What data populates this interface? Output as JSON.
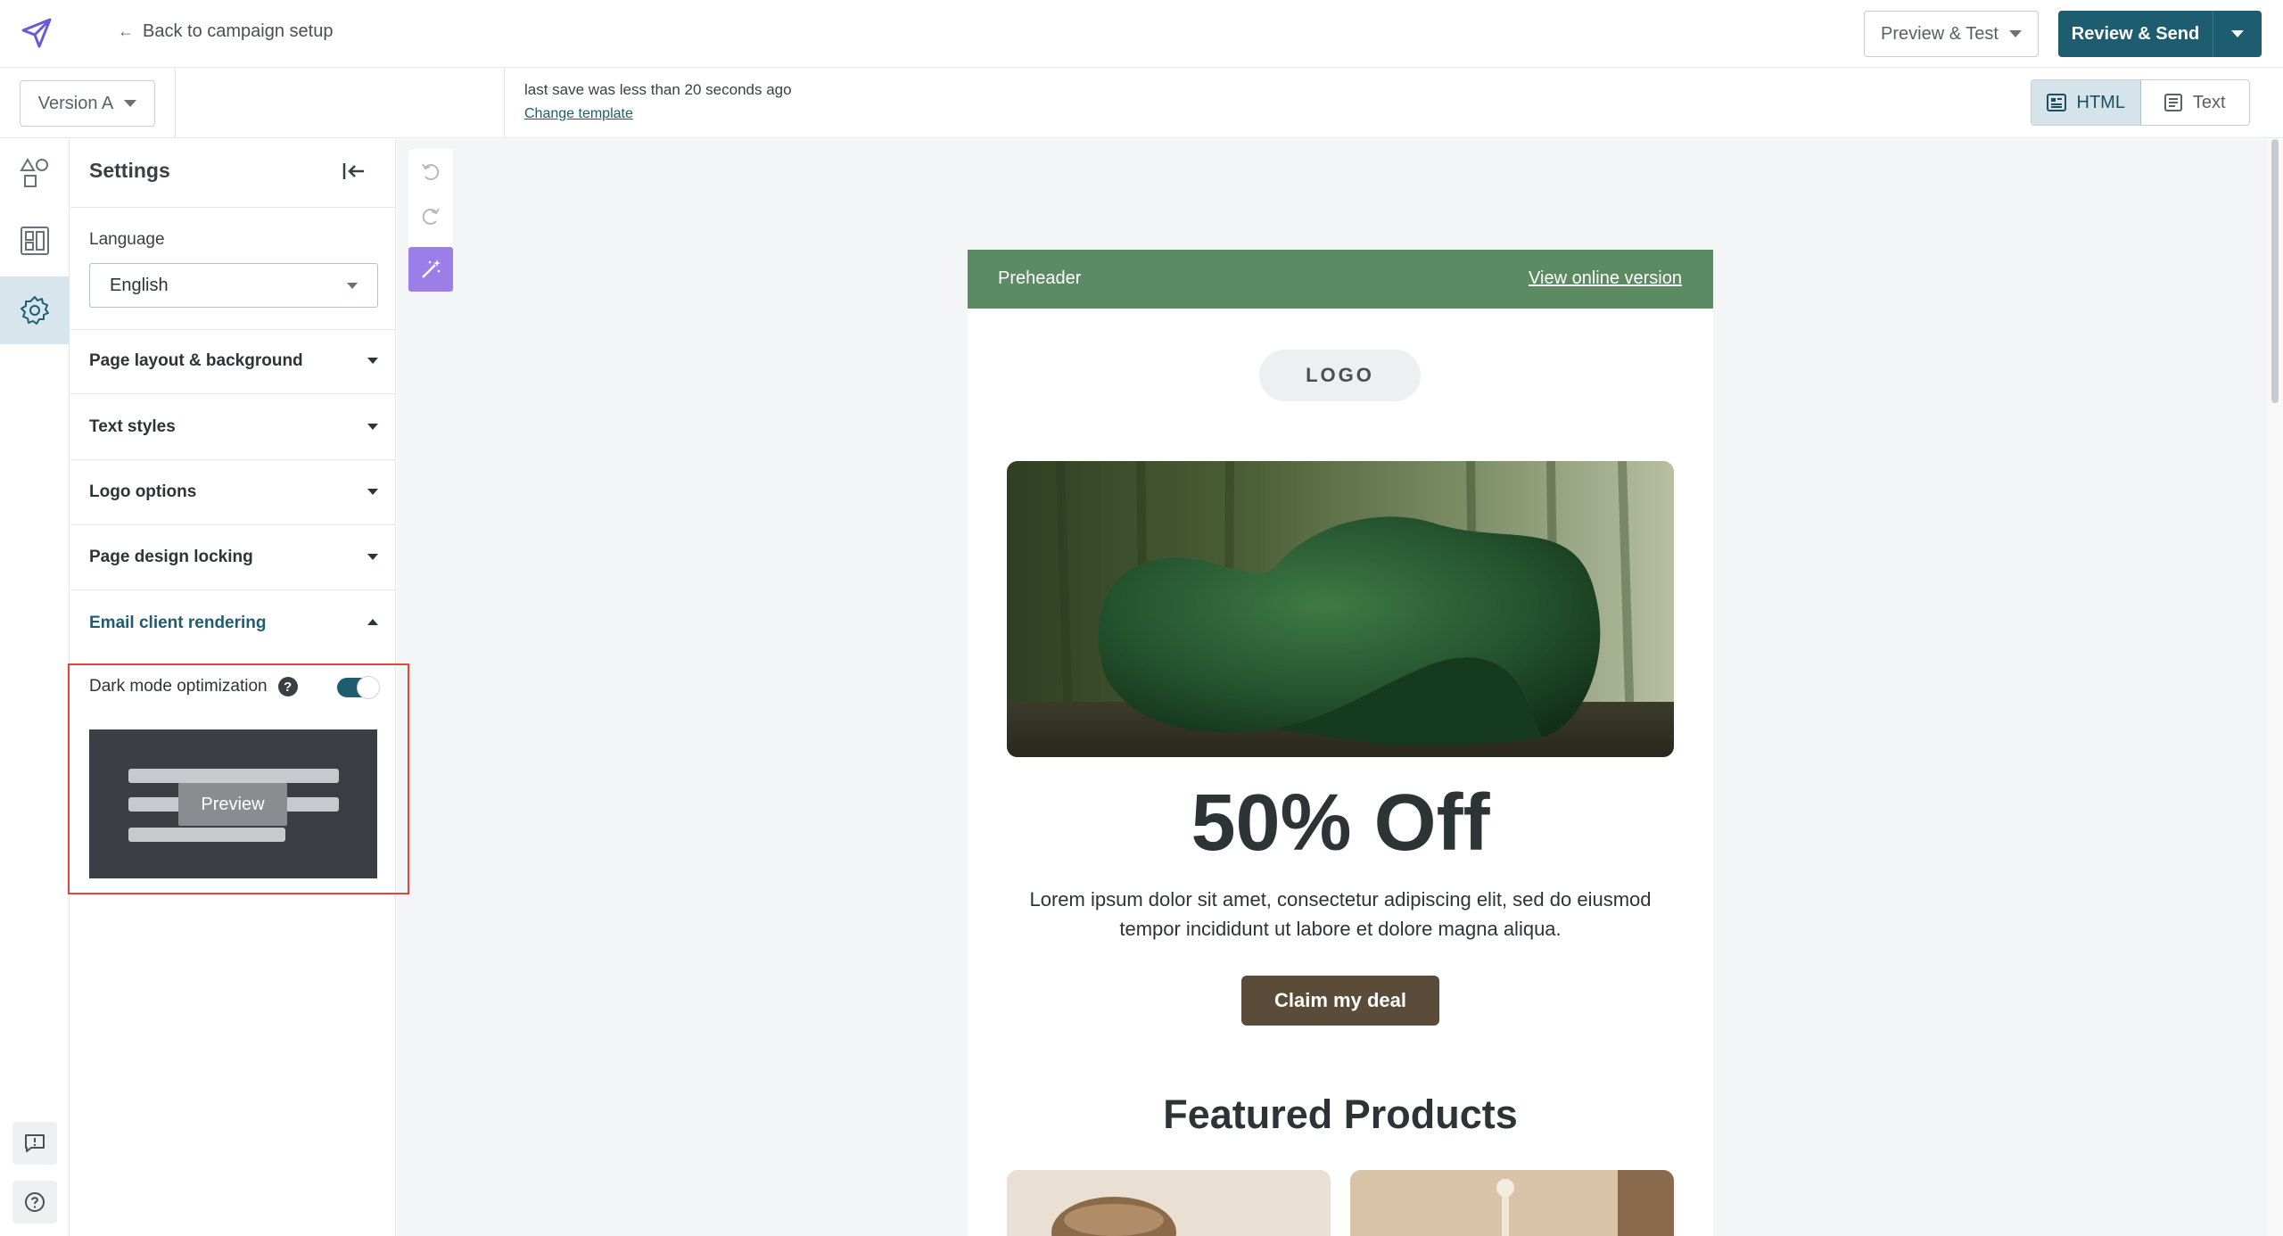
{
  "topbar": {
    "back_label": "Back to campaign setup",
    "preview_test_label": "Preview & Test",
    "review_send_label": "Review & Send"
  },
  "subbar": {
    "version_label": "Version A",
    "save_status": "last save was less than 20 seconds ago",
    "change_template_label": "Change template",
    "view_html_label": "HTML",
    "view_text_label": "Text"
  },
  "rail": {
    "icons": [
      "shapes-icon",
      "layout-icon",
      "gear-icon",
      "feedback-icon",
      "help-icon"
    ],
    "active_index": 2
  },
  "settings": {
    "title": "Settings",
    "language_label": "Language",
    "language_value": "English",
    "sections": [
      {
        "label": "Page layout & background",
        "open": false
      },
      {
        "label": "Text styles",
        "open": false
      },
      {
        "label": "Logo options",
        "open": false
      },
      {
        "label": "Page design locking",
        "open": false
      },
      {
        "label": "Email client rendering",
        "open": true
      }
    ],
    "dark_mode": {
      "label": "Dark mode optimization",
      "help": "?",
      "enabled": true,
      "preview_label": "Preview"
    }
  },
  "email": {
    "preheader": "Preheader",
    "view_online": "View online version",
    "logo": "LOGO",
    "headline": "50% Off",
    "body": "Lorem ipsum dolor sit amet, consectetur adipiscing elit, sed do eiusmod tempor incididunt ut labore et dolore magna aliqua.",
    "cta": "Claim my deal",
    "featured_title": "Featured Products"
  },
  "colors": {
    "accent": "#1d5d6f",
    "preheader_bg": "#5c8a62",
    "cta_bg": "#5b4c3a",
    "highlight_border": "#e2453a",
    "magic_tool": "#9b7ee8"
  }
}
